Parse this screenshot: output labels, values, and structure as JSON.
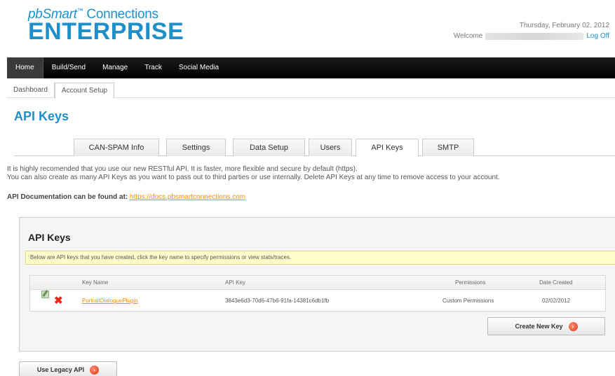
{
  "header": {
    "logo_prefix": "pbSmart",
    "logo_tm": "™",
    "logo_suffix": "Connections",
    "logo_main": "ENTERPRISE",
    "date": "Thursday, February 02, 2012",
    "welcome_label": "Welcome",
    "logoff_label": "Log Off"
  },
  "main_nav": [
    "Home",
    "Build/Send",
    "Manage",
    "Track",
    "Social Media"
  ],
  "sub_nav": [
    "Dashboard",
    "Account Setup"
  ],
  "page_title": "API Keys",
  "tabs": [
    "CAN-SPAM Info",
    "Settings",
    "Data Setup",
    "Users",
    "API Keys",
    "SMTP"
  ],
  "intro": {
    "line1": "It is highly recomended that you use our new RESTful API. It is faster, more flexible and secure by default (https).",
    "line2": "You can also create as many API Keys as you want to pass out to third parties or use internally. Delete API Keys at any time to remove access to your account."
  },
  "doc": {
    "label": "API Documentation can be found at:",
    "link": "https://docs.pbsmartconnections.com"
  },
  "panel": {
    "title": "API Keys",
    "notice": "Below are API keys that you have created, click the key name to specify permissions or view stats/traces.",
    "columns": [
      "Key Name",
      "API Key",
      "Permissions",
      "Date Created"
    ],
    "rows": [
      {
        "key_name": "PortraitDialoguePlugin",
        "api_key": "3843e6d3-70d6-47b6-91fa-14381c6db1fb",
        "permissions": "Custom Permissions",
        "date_created": "02/02/2012"
      }
    ],
    "create_button": "Create New Key"
  },
  "legacy_button": "Use Legacy API",
  "colors": {
    "accent": "#1f8fc9",
    "link": "#ff8c00",
    "nav": "#000000",
    "notice": "#fffccc"
  },
  "icons": {
    "edit": "edit-icon",
    "delete": "delete-icon",
    "arrow": "arrow-right-icon"
  }
}
